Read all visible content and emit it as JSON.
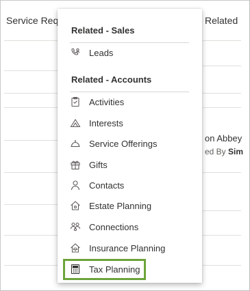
{
  "background": {
    "col_left_header": "Service Requ",
    "col_right_header": "Related",
    "row_text_1": "on Abbey",
    "row_text_2_prefix": "ed By ",
    "row_text_2_bold": "Sim"
  },
  "menu": {
    "groups": [
      {
        "header": "Related - Sales",
        "items": [
          {
            "label": "Leads",
            "icon": "leads-icon"
          }
        ]
      },
      {
        "header": "Related - Accounts",
        "items": [
          {
            "label": "Activities",
            "icon": "clipboard-icon"
          },
          {
            "label": "Interests",
            "icon": "interests-icon"
          },
          {
            "label": "Service Offerings",
            "icon": "service-bell-icon"
          },
          {
            "label": "Gifts",
            "icon": "gift-icon"
          },
          {
            "label": "Contacts",
            "icon": "person-icon"
          },
          {
            "label": "Estate Planning",
            "icon": "house-icon"
          },
          {
            "label": "Connections",
            "icon": "connections-icon"
          },
          {
            "label": "Insurance Planning",
            "icon": "insurance-house-icon"
          },
          {
            "label": "Tax Planning",
            "icon": "calculator-icon"
          }
        ]
      }
    ],
    "highlighted_item": "Tax Planning",
    "highlight_color": "#6ba43a"
  }
}
